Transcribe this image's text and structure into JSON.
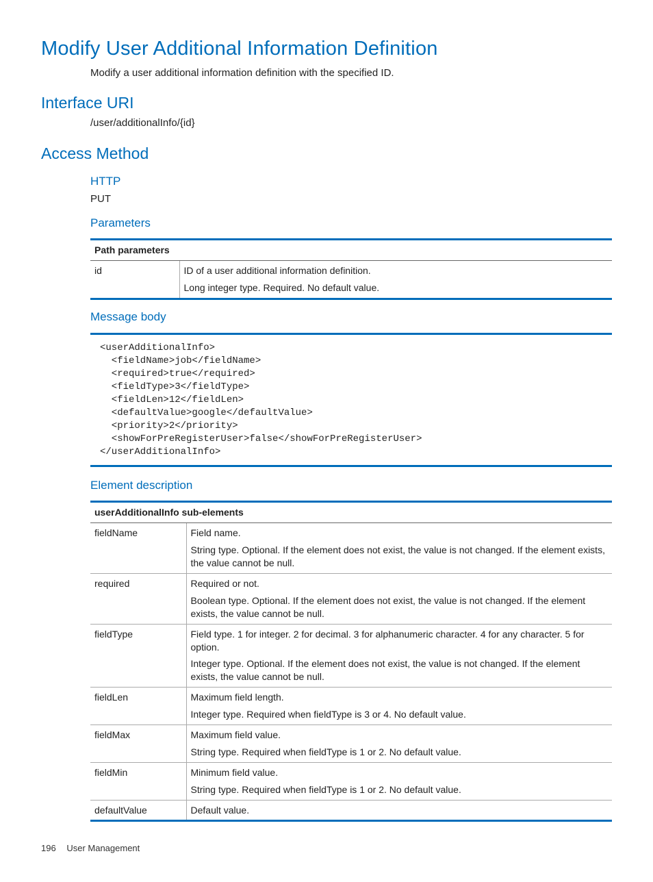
{
  "h1": "Modify User Additional Information Definition",
  "desc": "Modify a user additional information definition with the specified ID.",
  "interface_uri": {
    "title": "Interface URI",
    "value": "/user/additionalInfo/{id}"
  },
  "access_method": {
    "title": "Access Method",
    "http": {
      "title": "HTTP",
      "method": "PUT"
    },
    "parameters": {
      "title": "Parameters",
      "table_header": "Path parameters",
      "rows": [
        {
          "k": "id",
          "v1": "ID of a user additional information definition.",
          "v2": "Long integer type. Required. No default value."
        }
      ]
    },
    "message_body": {
      "title": "Message body",
      "code": "<userAdditionalInfo>\n  <fieldName>job</fieldName>\n  <required>true</required>\n  <fieldType>3</fieldType>\n  <fieldLen>12</fieldLen>\n  <defaultValue>google</defaultValue>\n  <priority>2</priority>\n  <showForPreRegisterUser>false</showForPreRegisterUser>\n</userAdditionalInfo>"
    },
    "element_description": {
      "title": "Element description",
      "table_header": "userAdditionalInfo sub-elements",
      "rows": [
        {
          "k": "fieldName",
          "v1": "Field name.",
          "v2": "String type. Optional. If the element does not exist, the value is not changed. If the element exists, the value cannot be null."
        },
        {
          "k": "required",
          "v1": "Required or not.",
          "v2": "Boolean type. Optional. If the element does not exist, the value is not changed. If the element exists, the value cannot be null."
        },
        {
          "k": "fieldType",
          "v1": "Field type. 1 for integer. 2 for decimal. 3 for alphanumeric character. 4 for any character. 5 for option.",
          "v2": "Integer type. Optional. If the element does not exist, the value is not changed. If the element exists, the value cannot be null."
        },
        {
          "k": "fieldLen",
          "v1": "Maximum field length.",
          "v2": "Integer type. Required when fieldType is 3 or 4. No default value."
        },
        {
          "k": "fieldMax",
          "v1": "Maximum field value.",
          "v2": "String type. Required when fieldType is 1 or 2. No default value."
        },
        {
          "k": "fieldMin",
          "v1": "Minimum field value.",
          "v2": "String type. Required when fieldType is 1 or 2. No default value."
        },
        {
          "k": "defaultValue",
          "v1": "Default value."
        }
      ]
    }
  },
  "footer": {
    "page_number": "196",
    "section": "User Management"
  }
}
